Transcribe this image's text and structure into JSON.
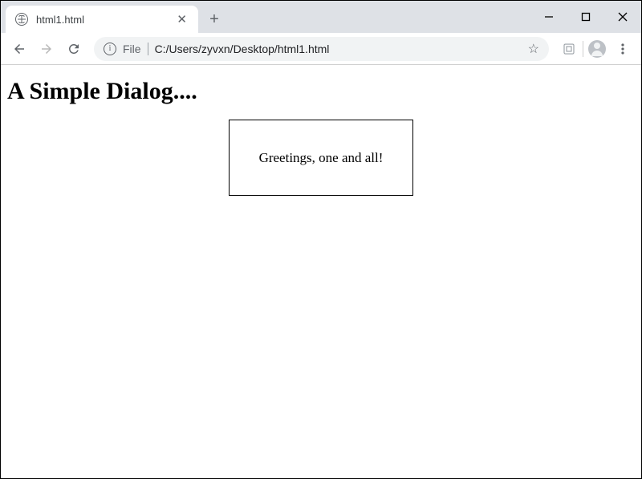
{
  "tab": {
    "title": "html1.html"
  },
  "toolbar": {
    "scheme_label": "File",
    "url": "C:/Users/zyvxn/Desktop/html1.html"
  },
  "page": {
    "heading": "A Simple Dialog....",
    "dialog_text": "Greetings, one and all!"
  }
}
